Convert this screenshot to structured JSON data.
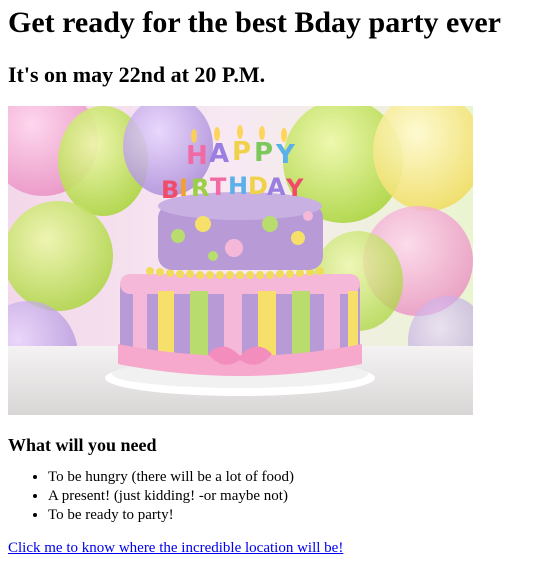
{
  "page": {
    "title": "Get ready for the best Bday party ever",
    "subtitle": "It's on may 22nd at 20 P.M."
  },
  "hero_image": {
    "description_icon": "birthday-cake-image",
    "top_candles_text": "HAPPY",
    "bottom_candles_text": "BIRTHDAY",
    "colors": {
      "balloon_green": "#c8e65a",
      "balloon_pink": "#f4a6cf",
      "balloon_purple": "#c6a8e8",
      "cake_purple": "#b89ad6",
      "cake_pink": "#f6b8d8",
      "cake_yellow": "#f6e06a",
      "cake_green": "#b8dd6e"
    }
  },
  "needs": {
    "heading": "What will you need",
    "items": [
      "To be hungry (there will be a lot of food)",
      "A present! (just kidding! -or maybe not)",
      "To be ready to party!"
    ]
  },
  "location_link": {
    "label": "Click me to know where the incredible location will be!"
  }
}
